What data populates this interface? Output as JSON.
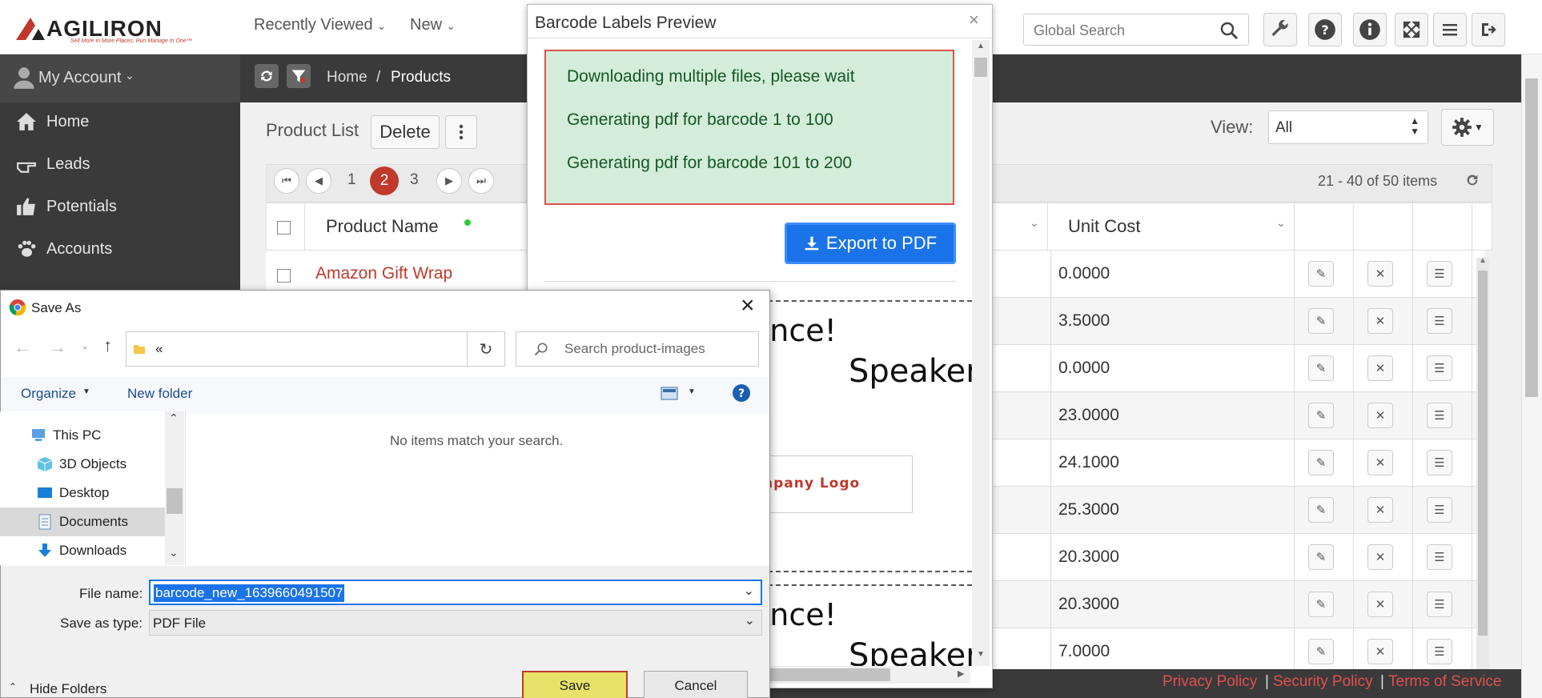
{
  "app": {
    "logo_text": "AGILIRON",
    "logo_tagline": "Sell More in More Places. Run Manage In One™"
  },
  "topnav": {
    "recent": "Recently Viewed",
    "new": "New"
  },
  "global_search": {
    "placeholder": "Global Search"
  },
  "sidebar": {
    "account": "My Account",
    "items": [
      {
        "label": "Home",
        "icon": "home-icon"
      },
      {
        "label": "Leads",
        "icon": "hand-point-icon"
      },
      {
        "label": "Potentials",
        "icon": "thumbs-up-icon"
      },
      {
        "label": "Accounts",
        "icon": "paw-icon"
      }
    ]
  },
  "breadcrumb": {
    "home": "Home",
    "sep": "/",
    "current": "Products"
  },
  "product_list": {
    "title": "Product List",
    "delete_label": "Delete"
  },
  "view": {
    "label": "View:",
    "value": "All"
  },
  "pager": {
    "pages": [
      "1",
      "2",
      "3"
    ],
    "current": "2",
    "summary": "21 - 40 of 50 items"
  },
  "table": {
    "col_name": "Product Name",
    "col_unit_cost": "Unit Cost",
    "first_row_name": "Amazon Gift Wrap",
    "unit_costs": [
      "0.0000",
      "3.5000",
      "0.0000",
      "23.0000",
      "24.1000",
      "25.3000",
      "20.3000",
      "20.3000",
      "7.0000"
    ]
  },
  "footer": {
    "privacy": "Privacy Policy",
    "security": "Security Policy",
    "terms": "Terms of Service",
    "sep": "|"
  },
  "modal": {
    "title": "Barcode Labels Preview",
    "messages": [
      "Downloading multiple files, please wait",
      "Generating pdf for barcode 1 to 100",
      "Generating pdf for barcode 101 to 200"
    ],
    "export_label": "Export to PDF",
    "label_text_1": "ance!",
    "label_text_2": "Speaker",
    "label_logo": "npany Logo"
  },
  "save_dialog": {
    "title": "Save As",
    "address": "«",
    "search_placeholder": "Search product-images",
    "organize": "Organize",
    "new_folder": "New folder",
    "empty_msg": "No items match your search.",
    "tree": [
      {
        "label": "This PC",
        "icon": "computer-icon"
      },
      {
        "label": "3D Objects",
        "icon": "cube-icon"
      },
      {
        "label": "Desktop",
        "icon": "desktop-icon"
      },
      {
        "label": "Documents",
        "icon": "document-icon"
      },
      {
        "label": "Downloads",
        "icon": "download-icon"
      }
    ],
    "file_name_label": "File name:",
    "file_name_value": "barcode_new_1639660491507",
    "save_type_label": "Save as type:",
    "save_type_value": "PDF File",
    "hide_folders": "Hide Folders",
    "save_label": "Save",
    "cancel_label": "Cancel"
  },
  "colors": {
    "accent": "#c0392b",
    "export_blue": "#1a73e8",
    "alert_bg": "#d4edda",
    "link_red": "#e14f4f"
  }
}
